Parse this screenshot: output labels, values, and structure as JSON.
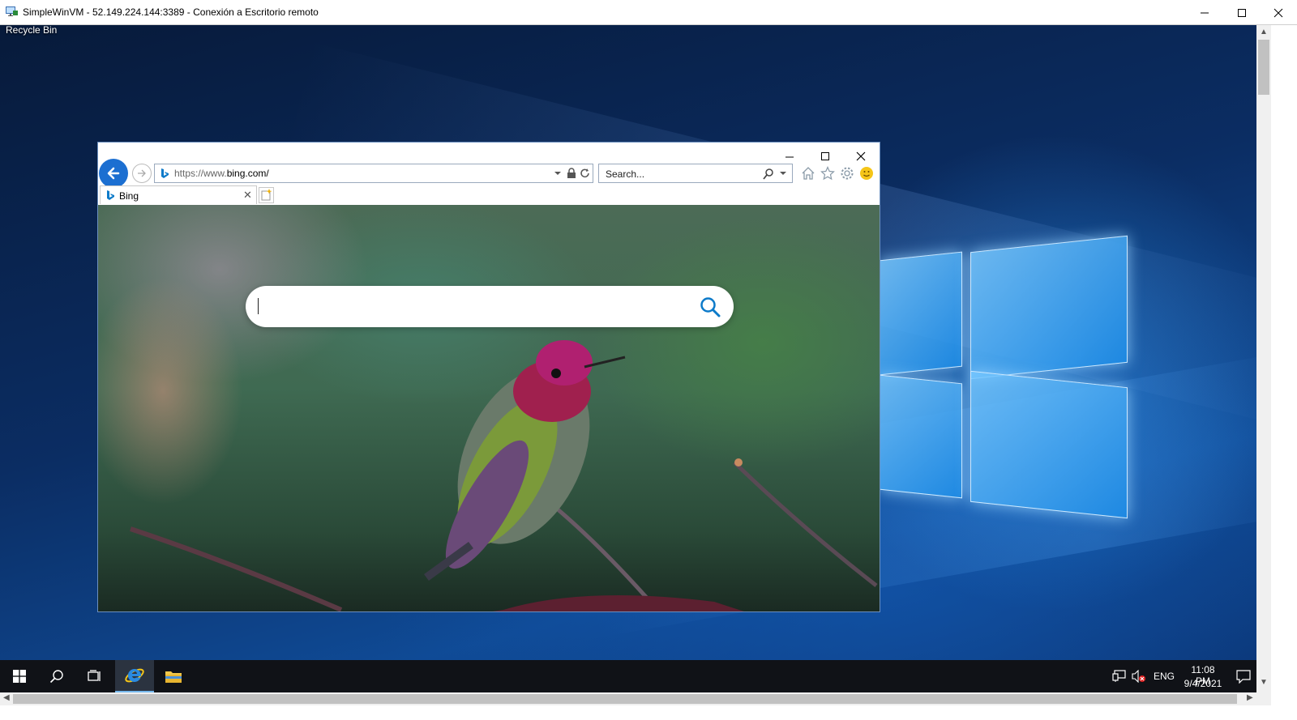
{
  "rdp_window": {
    "title": "SimpleWinVM - 52.149.224.144:3389 - Conexión a Escritorio remoto"
  },
  "desktop": {
    "recycle_bin_label": "Recycle Bin"
  },
  "browser": {
    "address_prefix": "https://www.",
    "address_host": "bing.com/",
    "search_placeholder": "Search...",
    "tab_label": "Bing"
  },
  "taskbar": {
    "language": "ENG",
    "time": "11:08 PM",
    "date": "9/4/2021"
  },
  "colors": {
    "ie_back_button": "#1c6fd1",
    "bing_blue": "#0c7ac9",
    "taskbar_bg": "#101217"
  }
}
